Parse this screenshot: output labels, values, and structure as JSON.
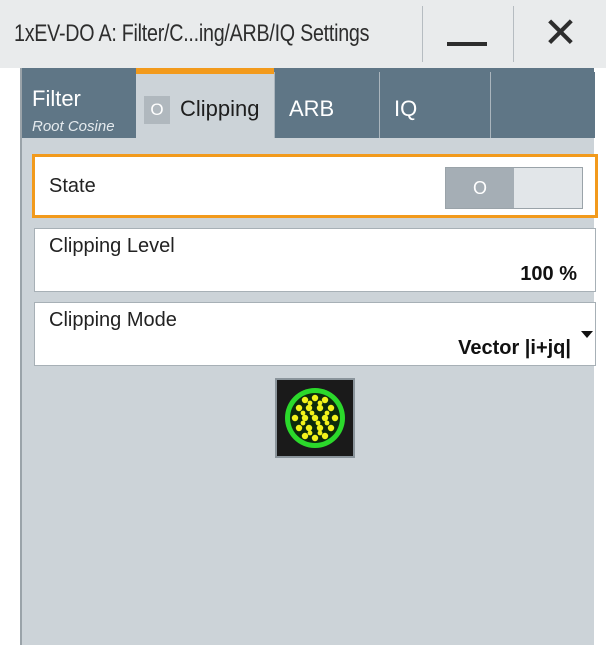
{
  "window": {
    "title": "1xEV-DO A: Filter/C...ing/ARB/IQ Settings",
    "minimize_icon": "minimize-icon",
    "close_glyph": "✕"
  },
  "tabs": {
    "filter": {
      "label": "Filter",
      "sublabel": "Root Cosine"
    },
    "clipping": {
      "indicator": "O",
      "label": "Clipping",
      "accent_color": "#f29a1c"
    },
    "arb": {
      "label": "ARB"
    },
    "iq": {
      "label": "IQ"
    }
  },
  "settings": {
    "state": {
      "label": "State",
      "value": "O"
    },
    "clipping_level": {
      "label": "Clipping Level",
      "value": "100 %"
    },
    "clipping_mode": {
      "label": "Clipping Mode",
      "value": "Vector |i+jq|"
    }
  },
  "constellation_button": {
    "icon": "constellation-diagram-icon"
  },
  "colors": {
    "accent": "#f29a1c",
    "tab_bg": "#5f7686",
    "panel_bg": "#ccd3d8"
  }
}
